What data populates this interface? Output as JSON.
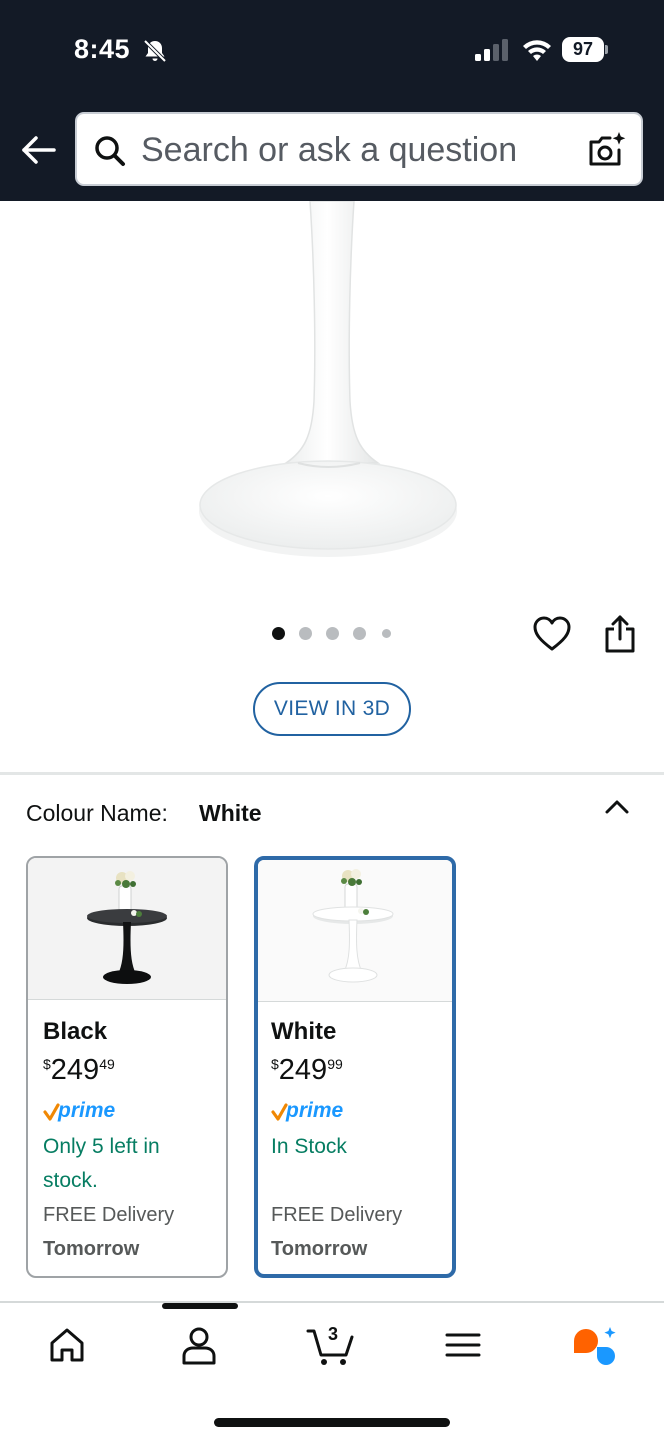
{
  "status_bar": {
    "time": "8:45",
    "battery": "97"
  },
  "search": {
    "placeholder": "Search or ask a question"
  },
  "product": {
    "image_count": 5,
    "active_image": 1,
    "view_3d_label": "VIEW IN 3D"
  },
  "colour": {
    "label": "Colour Name:",
    "selected": "White",
    "options": [
      {
        "name": "Black",
        "price_currency": "$",
        "price_whole": "249",
        "price_fraction": "49",
        "prime": "prime",
        "stock": "Only 5 left in stock.",
        "delivery": "FREE Delivery",
        "delivery_day": "Tomorrow"
      },
      {
        "name": "White",
        "price_currency": "$",
        "price_whole": "249",
        "price_fraction": "99",
        "prime": "prime",
        "stock": "In Stock",
        "delivery": "FREE Delivery",
        "delivery_day": "Tomorrow"
      }
    ]
  },
  "nav": {
    "cart_count": "3",
    "items": [
      "home-icon",
      "account-icon",
      "cart-icon",
      "menu-icon",
      "rufus-icon"
    ]
  },
  "colors": {
    "header_bg": "#131a26",
    "link_blue": "#2162a1",
    "stock_green": "#067d62",
    "prime_blue": "#1a98ff",
    "prime_check": "#f08804",
    "selected_border": "#2e6aa8"
  }
}
